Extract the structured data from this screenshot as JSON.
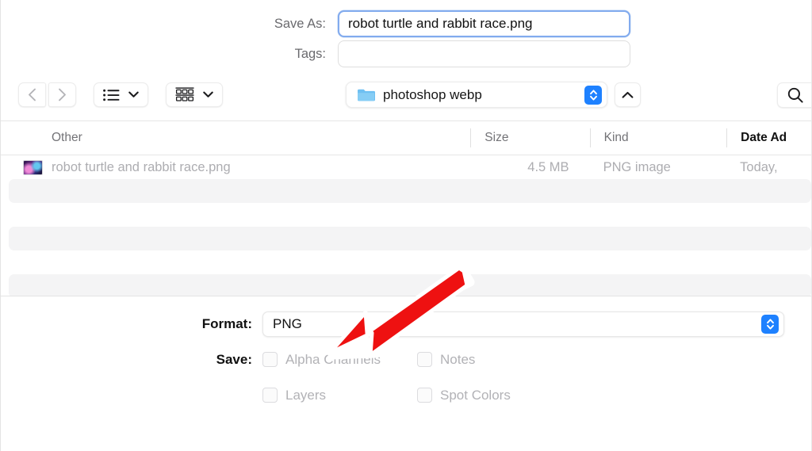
{
  "save_as": {
    "label": "Save As:",
    "value": "robot turtle and rabbit race.png",
    "placeholder": ""
  },
  "tags": {
    "label": "Tags:",
    "value": "",
    "placeholder": ""
  },
  "toolbar": {
    "back_icon": "chevron-left-icon",
    "forward_icon": "chevron-right-icon",
    "list_view_icon": "list-view-icon",
    "gallery_view_icon": "gallery-view-icon",
    "dropdown_icon": "chevron-down-icon",
    "folder_icon": "folder-icon",
    "path_value": "photoshop webp",
    "stepper_icon": "up-down-stepper-icon",
    "up_icon": "chevron-up-icon",
    "search_icon": "search-icon"
  },
  "columns": [
    {
      "label": "Other",
      "sorted": false
    },
    {
      "label": "Size",
      "sorted": false
    },
    {
      "label": "Kind",
      "sorted": false
    },
    {
      "label": "Date Ad",
      "sorted": true
    }
  ],
  "files": [
    {
      "icon": "png-thumbnail-icon",
      "name": "robot turtle and rabbit race.png",
      "size": "4.5 MB",
      "kind": "PNG image",
      "date_added": "Today,"
    }
  ],
  "format": {
    "label": "Format:",
    "value": "PNG",
    "stepper_icon": "up-down-stepper-icon"
  },
  "save_options": {
    "label": "Save:",
    "items": [
      {
        "label": "Alpha Channels",
        "checked": false,
        "enabled": false
      },
      {
        "label": "Notes",
        "checked": false,
        "enabled": false
      },
      {
        "label": "Layers",
        "checked": false,
        "enabled": false
      },
      {
        "label": "Spot Colors",
        "checked": false,
        "enabled": false
      }
    ]
  },
  "annotation": {
    "type": "red-arrow",
    "points_to": "format-dropdown",
    "color": "#ee1111",
    "outline_color": "#ffffff"
  },
  "colors": {
    "accent_blue": "#1e81ff",
    "focus_ring": "#82abee",
    "stripe": "#f4f4f5",
    "disabled_text": "#b2b2b6"
  }
}
